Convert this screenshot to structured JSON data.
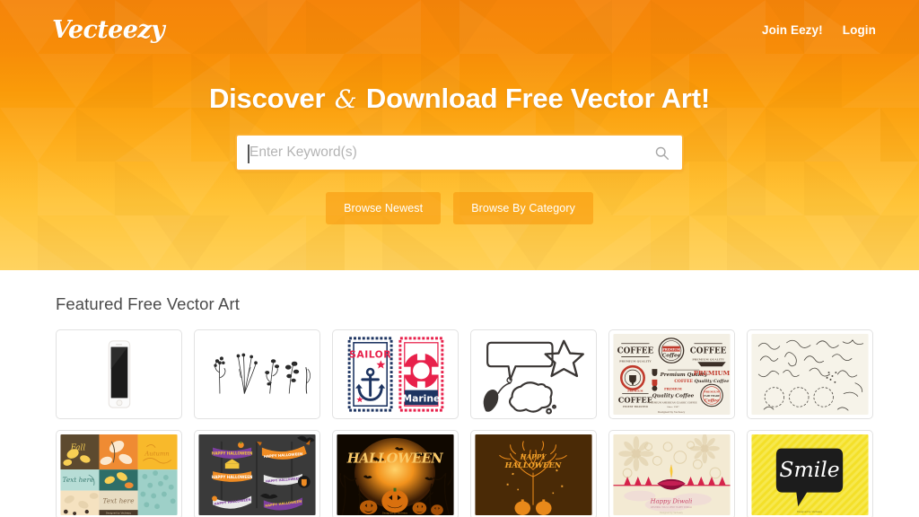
{
  "header": {
    "logo_text": "Vecteezy",
    "nav": [
      {
        "label": "Join Eezy!",
        "name": "join-eezy-link"
      },
      {
        "label": "Login",
        "name": "login-link"
      }
    ]
  },
  "hero": {
    "headline_before": "Discover",
    "headline_amp": "&",
    "headline_after": "Download Free Vector Art!",
    "search": {
      "placeholder": "Enter Keyword(s)",
      "value": "",
      "icon": "search-icon"
    },
    "buttons": [
      {
        "label": "Browse Newest",
        "name": "browse-newest-button"
      },
      {
        "label": "Browse By Category",
        "name": "browse-by-category-button"
      }
    ],
    "colors": {
      "gradient_top": "#f5840a",
      "gradient_bottom": "#ffd158",
      "search_border": "#fcb131",
      "button_bg": "rgba(247,150,10,.55)"
    }
  },
  "featured": {
    "title": "Featured Free Vector Art",
    "items": [
      {
        "name": "thumb-white-smartphone",
        "alt": "White smartphone mockup"
      },
      {
        "name": "thumb-floral-sketches",
        "alt": "Black hand drawn flower sketches"
      },
      {
        "name": "thumb-sailor-marine-stamps",
        "alt": "Sailor and Marine nautical stamps",
        "labels": [
          "SAILOR",
          "Marine"
        ]
      },
      {
        "name": "thumb-speech-bubbles",
        "alt": "Hand drawn speech bubbles and star"
      },
      {
        "name": "thumb-coffee-labels",
        "alt": "Premium quality coffee labels set",
        "labels": [
          "COFFEE",
          "PREMIUM",
          "Premium Quality"
        ]
      },
      {
        "name": "thumb-ornament-flourishes",
        "alt": "Hand drawn ornament flourishes and wreaths"
      },
      {
        "name": "thumb-fall-autumn-patterns",
        "alt": "Fall and autumn pattern cards",
        "labels": [
          "Fall",
          "Autumn",
          "Text here"
        ]
      },
      {
        "name": "thumb-halloween-banners",
        "alt": "Happy Halloween ribbon banners",
        "labels": [
          "HAPPY HALLOWEEN"
        ]
      },
      {
        "name": "thumb-halloween-moon-scene",
        "alt": "Halloween night scene with pumpkins",
        "labels": [
          "HALLOWEEN"
        ]
      },
      {
        "name": "thumb-halloween-tree",
        "alt": "Happy Halloween tree with pumpkins",
        "labels": [
          "HAPPY HALLOWEEN"
        ]
      },
      {
        "name": "thumb-happy-diwali",
        "alt": "Happy Diwali lamps greeting",
        "labels": [
          "Happy Diwali"
        ]
      },
      {
        "name": "thumb-smile-speech-bubble",
        "alt": "Smile brush lettering speech bubble",
        "labels": [
          "Smile"
        ]
      }
    ]
  }
}
